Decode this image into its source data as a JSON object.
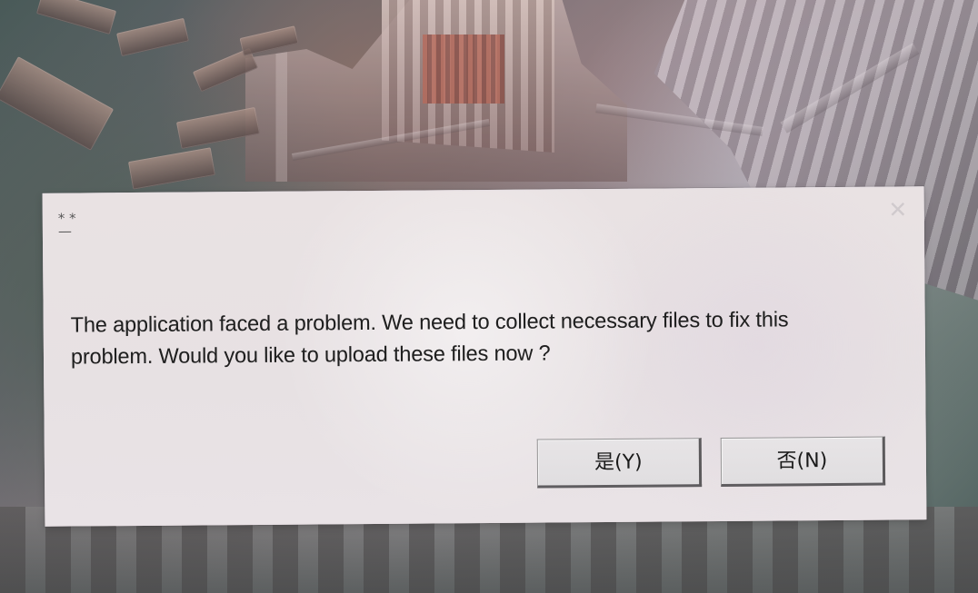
{
  "dialog": {
    "title": "* *\n—",
    "close_symbol": "✕",
    "message": "The application faced a problem. We need to collect necessary files to fix this problem. Would you like to upload these files now ?",
    "buttons": {
      "yes": "是(Y)",
      "no": "否(N)"
    }
  },
  "icons": {
    "close": "close-icon"
  },
  "colors": {
    "dialog_background": "#e8e1e3",
    "text": "#1f1f1f",
    "button_border": "#5f5d60"
  }
}
